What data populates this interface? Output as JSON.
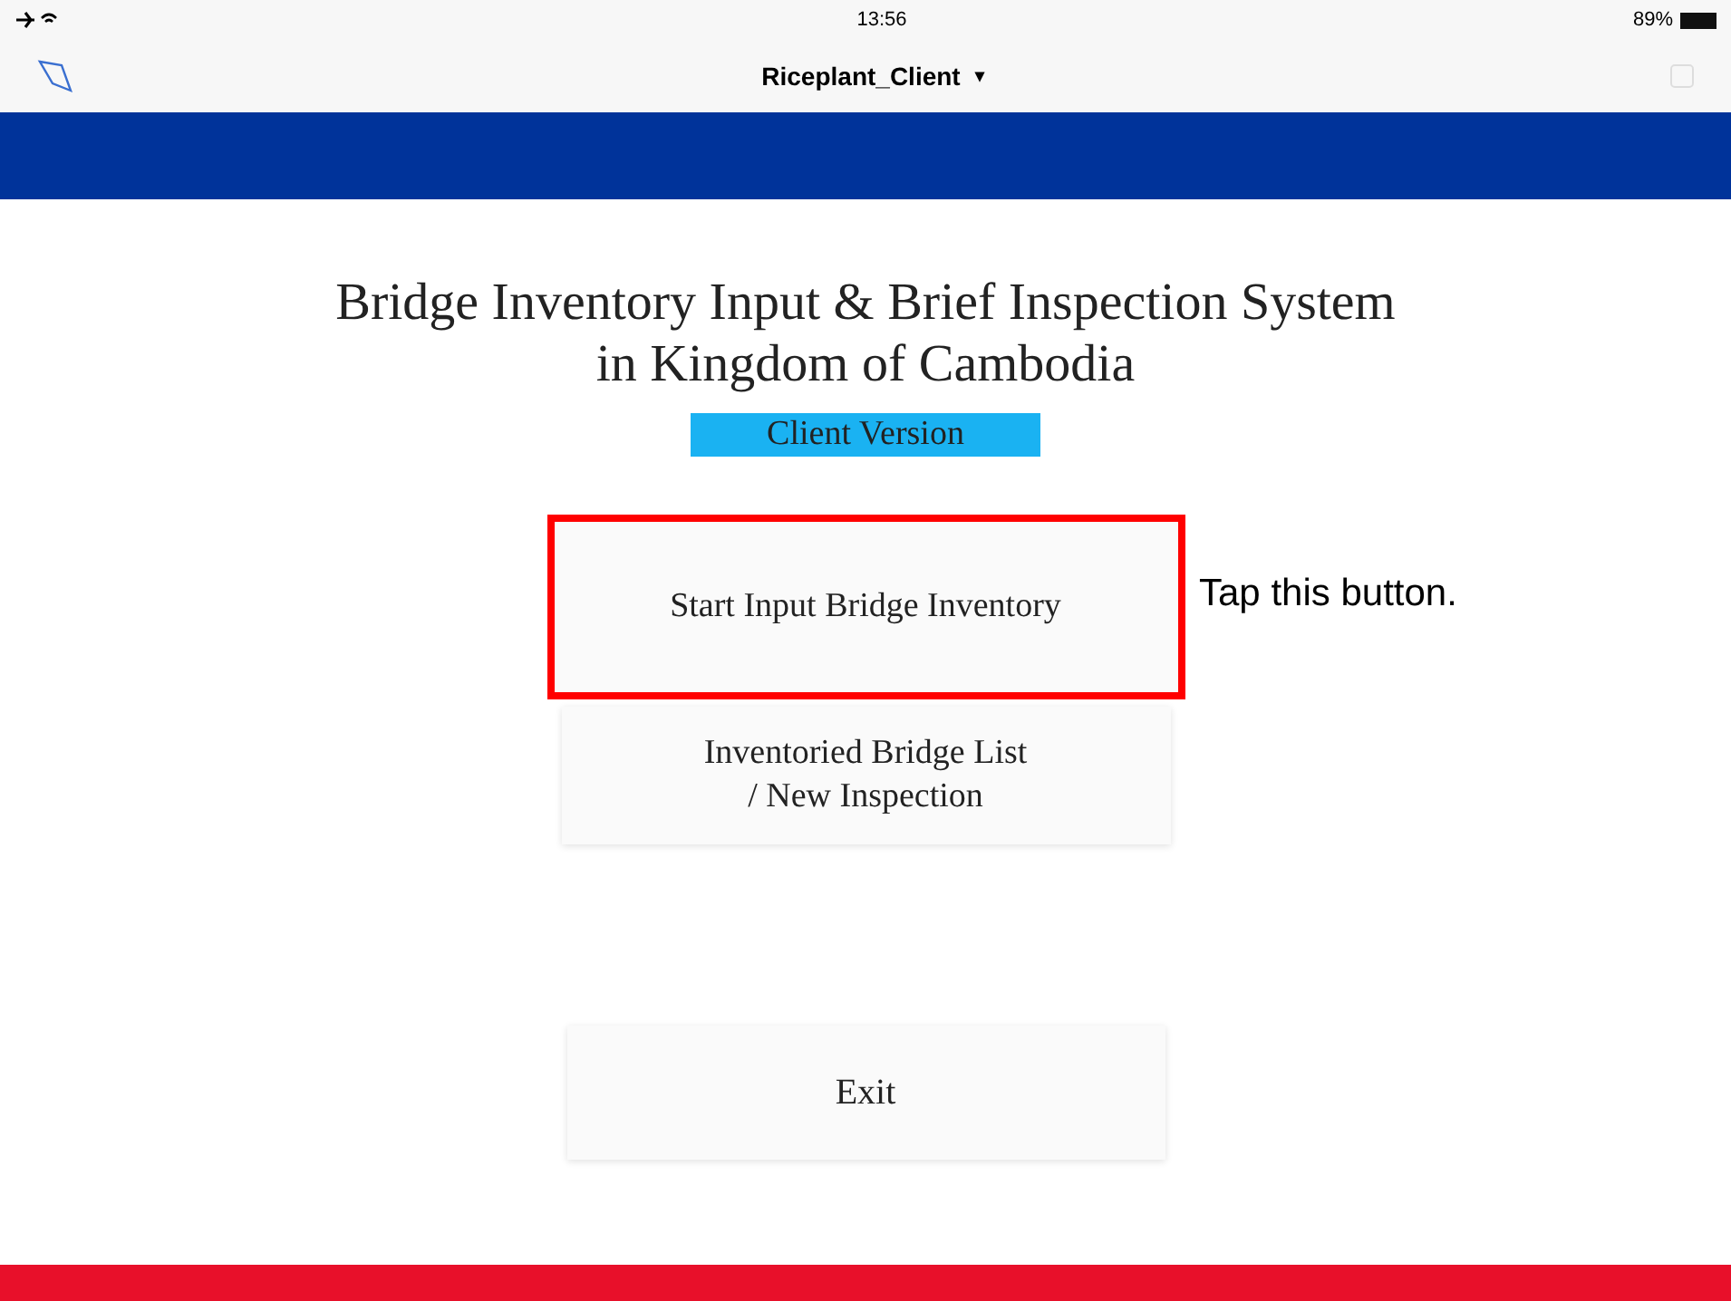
{
  "status_bar": {
    "time": "13:56",
    "battery": "89%"
  },
  "nav_bar": {
    "title": "Riceplant_Client",
    "caret": "▾"
  },
  "title_lines": [
    "Bridge Inventory Input & Brief Inspection System",
    "in Kingdom of Cambodia"
  ],
  "version_badge": "Client Version",
  "menu_buttons": [
    {
      "lines": [
        "Start Input Bridge Inventory"
      ],
      "highlighted": true
    },
    {
      "lines": [
        "Inventoried Bridge List",
        "/ New Inspection"
      ],
      "highlighted": false
    }
  ],
  "callout": "Tap this button.",
  "exit_button": "Exit"
}
